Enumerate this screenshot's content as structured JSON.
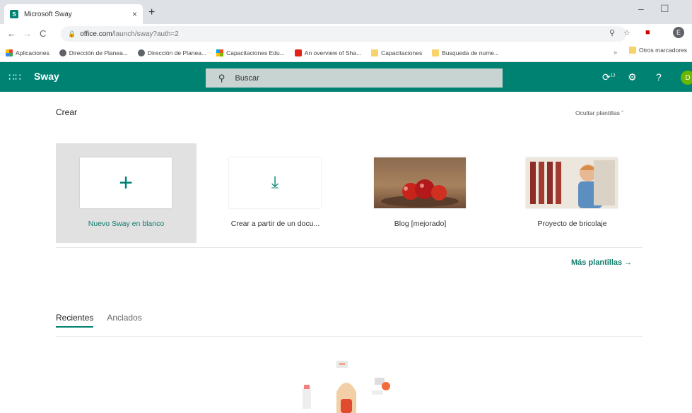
{
  "browser": {
    "tab_title": "Microsoft Sway",
    "new_tab": "+",
    "url_host": "office.com",
    "url_path": "/launch/sway?auth=2",
    "profile_initial": "E"
  },
  "bookmarks": {
    "items": [
      {
        "label": "Aplicaciones",
        "icon": "apps-grid-icon"
      },
      {
        "label": "Dirección de Planea...",
        "icon": "globe-icon"
      },
      {
        "label": "Dirección de Planea...",
        "icon": "globe-icon"
      },
      {
        "label": "Capacitaciones Edu...",
        "icon": "microsoft-icon"
      },
      {
        "label": "An overview of Sha...",
        "icon": "youtube-icon"
      },
      {
        "label": "Capacitaciones",
        "icon": "folder-icon"
      },
      {
        "label": "Busqueda de nume...",
        "icon": "folder-icon"
      }
    ],
    "more": "»",
    "other": "Otros marcadores"
  },
  "app": {
    "name": "Sway",
    "search_placeholder": "Buscar",
    "notification_count": "13",
    "user_initial": "D",
    "accent": "#008272"
  },
  "create": {
    "title": "Crear",
    "hide_templates": "Ocultar plantillas",
    "cards": [
      {
        "label": "Nuevo Sway en blanco"
      },
      {
        "label": "Crear a partir de un docu..."
      },
      {
        "label": "Blog [mejorado]"
      },
      {
        "label": "Proyecto de bricolaje"
      }
    ],
    "more_templates": "Más plantillas"
  },
  "recents": {
    "tabs": [
      {
        "label": "Recientes",
        "active": true
      },
      {
        "label": "Anclados",
        "active": false
      }
    ]
  }
}
